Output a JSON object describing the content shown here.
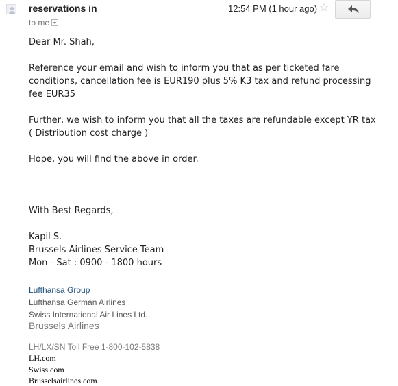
{
  "header": {
    "sender": "reservations in",
    "timestamp": "12:54 PM (1 hour ago)",
    "to_label": "to me",
    "star_icon": "star-icon",
    "reply_icon": "reply-icon"
  },
  "body": {
    "greeting": "Dear Mr. Shah,",
    "paragraph1": [
      "Reference your email and wish to inform you that as per ticketed fare",
      "conditions, cancellation fee is EUR190 plus 5% K3 tax and refund processing",
      "fee EUR35"
    ],
    "paragraph2": [
      "Further, we wish to inform you that all the taxes are refundable except YR tax",
      "( Distribution cost charge )"
    ],
    "paragraph3": "Hope, you will find the above in order.",
    "closing": "With Best Regards,",
    "signature": {
      "name": "Kapil S.",
      "team": "Brussels Airlines Service Team",
      "hours": "Mon - Sat : 0900 - 1800 hours"
    }
  },
  "footer": {
    "group": "Lufthansa Group",
    "airline1": "Lufthansa German Airlines",
    "airline2": "Swiss International Air Lines Ltd.",
    "airline3": "Brussels Airlines",
    "toll_free": "LH/LX/SN Toll Free 1-800-102-5838",
    "link1": "LH.com",
    "link2": "Swiss.com",
    "link3": "Brusselsairlines.com"
  },
  "colors": {
    "text": "#222222",
    "muted": "#777777",
    "signature_blue": "#1f4e79"
  }
}
